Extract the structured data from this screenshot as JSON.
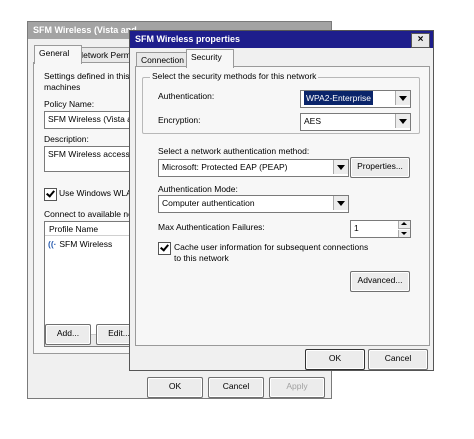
{
  "back_window": {
    "title": "SFM Wireless (Vista and",
    "tabs": [
      "General",
      "Network Permi"
    ],
    "settings_text_1": "Settings defined in this",
    "settings_text_2": "machines",
    "policy_name_label": "Policy Name:",
    "policy_name_value": "SFM Wireless (Vista an",
    "description_label": "Description:",
    "description_value": "SFM Wireless access p",
    "use_windows_wlan_label": "Use Windows WLAN",
    "connect_label": "Connect to available ne",
    "profile_column": "Profile Name",
    "profile_item": "SFM Wireless",
    "add_button": "Add...",
    "edit_button": "Edit...",
    "ok_button": "OK",
    "cancel_button": "Cancel",
    "apply_button": "Apply"
  },
  "front_window": {
    "title": "SFM Wireless properties",
    "close_glyph": "×",
    "tabs": [
      "Connection",
      "Security"
    ],
    "group_title": "Select the security methods for this network",
    "authentication_label": "Authentication:",
    "authentication_value": "WPA2-Enterprise",
    "encryption_label": "Encryption:",
    "encryption_value": "AES",
    "auth_method_label": "Select a network authentication method:",
    "auth_method_value": "Microsoft: Protected EAP (PEAP)",
    "properties_button": "Properties...",
    "auth_mode_label": "Authentication Mode:",
    "auth_mode_value": "Computer authentication",
    "max_failures_label": "Max Authentication Failures:",
    "max_failures_value": "1",
    "cache_label_1": "Cache user information for subsequent connections",
    "cache_label_2": "to this network",
    "advanced_button": "Advanced...",
    "ok_button": "OK",
    "cancel_button": "Cancel"
  }
}
